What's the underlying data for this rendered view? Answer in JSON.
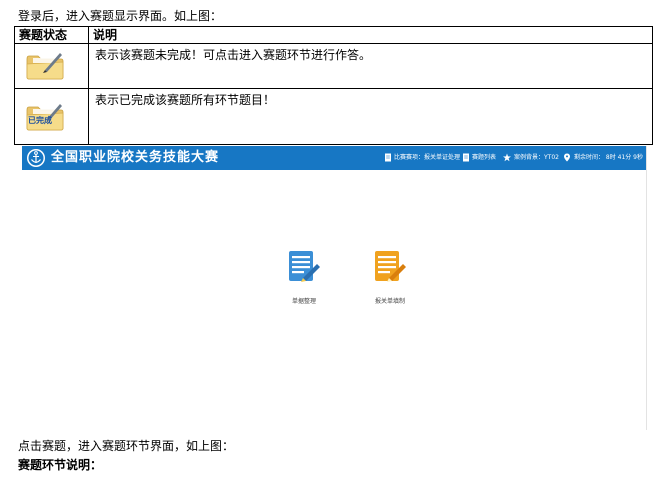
{
  "intro_text": "登录后，进入赛题显示界面。如上图：",
  "table": {
    "headers": [
      "赛题状态",
      "说明"
    ],
    "rows": [
      {
        "icon": "folder-pencil-icon",
        "description": "表示该赛题未完成！可点击进入赛题环节进行作答。"
      },
      {
        "icon": "folder-completed-icon",
        "badge": "已完成",
        "description": "表示已完成该赛题所有环节题目！"
      }
    ]
  },
  "app": {
    "title": "全国职业院校关务技能大赛",
    "header_items": {
      "event": "比赛赛项：报关单证处理",
      "list": "赛题列表",
      "case": "案例背景：YT02",
      "time": "剩余时间： 8时 41分 9秒"
    },
    "modules": [
      {
        "label": "单据整理",
        "icon": "document-pencil-icon"
      },
      {
        "label": "报关单填制",
        "icon": "form-pencil-icon"
      }
    ],
    "colors": {
      "header": "#1777c4",
      "module1": "#3b8fd6",
      "module2": "#f0a21f"
    }
  },
  "footer_text": "点击赛题，进入赛题环节界面，如上图：",
  "section_title": "赛题环节说明："
}
